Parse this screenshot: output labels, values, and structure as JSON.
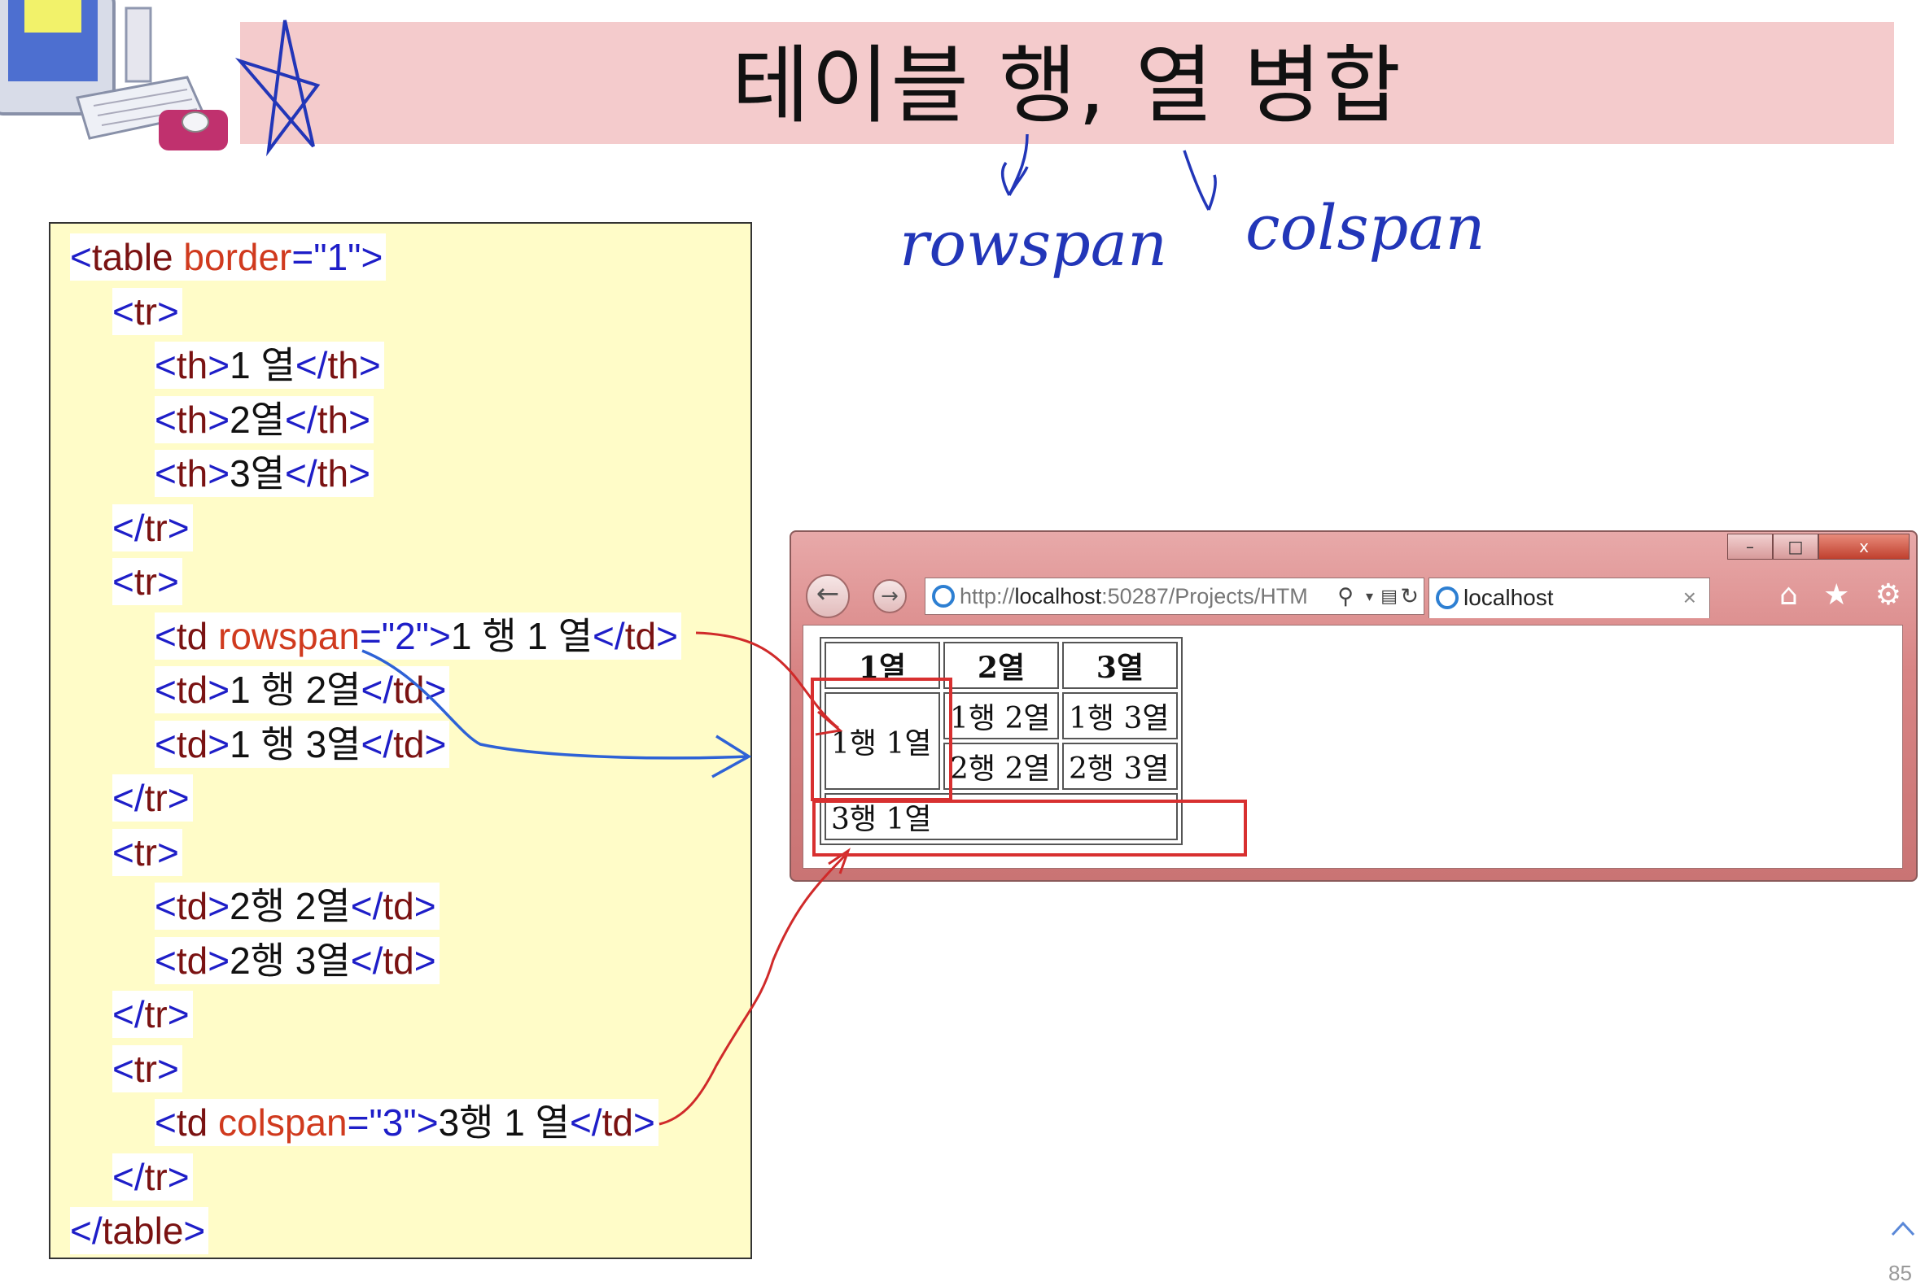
{
  "slide": {
    "title": "테이블 행, 열 병합",
    "page_number": "85"
  },
  "annotations": {
    "rowspan_note": "rowspan",
    "colspan_note": "colspan"
  },
  "code_lines": [
    {
      "indent": 0,
      "tokens": [
        {
          "t": "tag",
          "v": "<"
        },
        {
          "t": "ele",
          "v": "table"
        },
        {
          "t": "attr",
          "v": " border"
        },
        {
          "t": "tag",
          "v": "=\"1\">"
        }
      ]
    },
    {
      "indent": 1,
      "tokens": [
        {
          "t": "tag",
          "v": "<"
        },
        {
          "t": "ele",
          "v": "tr"
        },
        {
          "t": "tag",
          "v": ">"
        }
      ]
    },
    {
      "indent": 2,
      "tokens": [
        {
          "t": "tag",
          "v": "<"
        },
        {
          "t": "ele",
          "v": "th"
        },
        {
          "t": "tag",
          "v": ">"
        },
        {
          "t": "txt",
          "v": "1 열"
        },
        {
          "t": "tag",
          "v": "</"
        },
        {
          "t": "ele",
          "v": "th"
        },
        {
          "t": "tag",
          "v": ">"
        }
      ]
    },
    {
      "indent": 2,
      "tokens": [
        {
          "t": "tag",
          "v": "<"
        },
        {
          "t": "ele",
          "v": "th"
        },
        {
          "t": "tag",
          "v": ">"
        },
        {
          "t": "txt",
          "v": "2열"
        },
        {
          "t": "tag",
          "v": "</"
        },
        {
          "t": "ele",
          "v": "th"
        },
        {
          "t": "tag",
          "v": ">"
        }
      ]
    },
    {
      "indent": 2,
      "tokens": [
        {
          "t": "tag",
          "v": "<"
        },
        {
          "t": "ele",
          "v": "th"
        },
        {
          "t": "tag",
          "v": ">"
        },
        {
          "t": "txt",
          "v": "3열"
        },
        {
          "t": "tag",
          "v": "</"
        },
        {
          "t": "ele",
          "v": "th"
        },
        {
          "t": "tag",
          "v": ">"
        }
      ]
    },
    {
      "indent": 1,
      "tokens": [
        {
          "t": "tag",
          "v": "</"
        },
        {
          "t": "ele",
          "v": "tr"
        },
        {
          "t": "tag",
          "v": ">"
        }
      ]
    },
    {
      "indent": 1,
      "tokens": [
        {
          "t": "tag",
          "v": "<"
        },
        {
          "t": "ele",
          "v": "tr"
        },
        {
          "t": "tag",
          "v": ">"
        }
      ]
    },
    {
      "indent": 2,
      "tokens": [
        {
          "t": "tag",
          "v": "<"
        },
        {
          "t": "ele",
          "v": "td"
        },
        {
          "t": "attr",
          "v": " rowspan"
        },
        {
          "t": "tag",
          "v": "=\"2\">"
        },
        {
          "t": "txt",
          "v": "1 행 1 열"
        },
        {
          "t": "tag",
          "v": "</"
        },
        {
          "t": "ele",
          "v": "td"
        },
        {
          "t": "tag",
          "v": ">"
        }
      ]
    },
    {
      "indent": 2,
      "tokens": [
        {
          "t": "tag",
          "v": "<"
        },
        {
          "t": "ele",
          "v": "td"
        },
        {
          "t": "tag",
          "v": ">"
        },
        {
          "t": "txt",
          "v": "1 행 2열"
        },
        {
          "t": "tag",
          "v": "</"
        },
        {
          "t": "ele",
          "v": "td"
        },
        {
          "t": "tag",
          "v": ">"
        }
      ]
    },
    {
      "indent": 2,
      "tokens": [
        {
          "t": "tag",
          "v": "<"
        },
        {
          "t": "ele",
          "v": "td"
        },
        {
          "t": "tag",
          "v": ">"
        },
        {
          "t": "txt",
          "v": "1 행 3열"
        },
        {
          "t": "tag",
          "v": "</"
        },
        {
          "t": "ele",
          "v": "td"
        },
        {
          "t": "tag",
          "v": ">"
        }
      ]
    },
    {
      "indent": 1,
      "tokens": [
        {
          "t": "tag",
          "v": "</"
        },
        {
          "t": "ele",
          "v": "tr"
        },
        {
          "t": "tag",
          "v": ">"
        }
      ]
    },
    {
      "indent": 1,
      "tokens": [
        {
          "t": "tag",
          "v": "<"
        },
        {
          "t": "ele",
          "v": "tr"
        },
        {
          "t": "tag",
          "v": ">"
        }
      ]
    },
    {
      "indent": 2,
      "tokens": [
        {
          "t": "tag",
          "v": "<"
        },
        {
          "t": "ele",
          "v": "td"
        },
        {
          "t": "tag",
          "v": ">"
        },
        {
          "t": "txt",
          "v": "2행 2열"
        },
        {
          "t": "tag",
          "v": "</"
        },
        {
          "t": "ele",
          "v": "td"
        },
        {
          "t": "tag",
          "v": ">"
        }
      ]
    },
    {
      "indent": 2,
      "tokens": [
        {
          "t": "tag",
          "v": "<"
        },
        {
          "t": "ele",
          "v": "td"
        },
        {
          "t": "tag",
          "v": ">"
        },
        {
          "t": "txt",
          "v": "2행 3열"
        },
        {
          "t": "tag",
          "v": "</"
        },
        {
          "t": "ele",
          "v": "td"
        },
        {
          "t": "tag",
          "v": ">"
        }
      ]
    },
    {
      "indent": 1,
      "tokens": [
        {
          "t": "tag",
          "v": "</"
        },
        {
          "t": "ele",
          "v": "tr"
        },
        {
          "t": "tag",
          "v": ">"
        }
      ]
    },
    {
      "indent": 1,
      "tokens": [
        {
          "t": "tag",
          "v": "<"
        },
        {
          "t": "ele",
          "v": "tr"
        },
        {
          "t": "tag",
          "v": ">"
        }
      ]
    },
    {
      "indent": 2,
      "tokens": [
        {
          "t": "tag",
          "v": "<"
        },
        {
          "t": "ele",
          "v": "td"
        },
        {
          "t": "attr",
          "v": " colspan"
        },
        {
          "t": "tag",
          "v": "=\"3\">"
        },
        {
          "t": "txt",
          "v": "3행 1 열"
        },
        {
          "t": "tag",
          "v": "</"
        },
        {
          "t": "ele",
          "v": "td"
        },
        {
          "t": "tag",
          "v": ">"
        }
      ]
    },
    {
      "indent": 1,
      "tokens": [
        {
          "t": "tag",
          "v": "</"
        },
        {
          "t": "ele",
          "v": "tr"
        },
        {
          "t": "tag",
          "v": ">"
        }
      ]
    },
    {
      "indent": 0,
      "tokens": [
        {
          "t": "tag",
          "v": "</"
        },
        {
          "t": "ele",
          "v": "table"
        },
        {
          "t": "tag",
          "v": ">"
        }
      ]
    }
  ],
  "browser": {
    "address_url_prefix": "http://",
    "address_url_host": "localhost",
    "address_url_rest": ":50287/Projects/HTM",
    "tab_title": "localhost",
    "tab_close": "×",
    "window_controls": {
      "minimize": "–",
      "maximize": "□",
      "close": "x"
    },
    "icons": {
      "back": "back-arrow-icon",
      "forward": "forward-arrow-icon",
      "home": "home-icon",
      "favorites": "star-icon",
      "settings": "gear-icon",
      "search": "search-icon",
      "refresh": "refresh-icon",
      "compat": "compat-view-icon"
    },
    "table": {
      "headers": [
        "1열",
        "2열",
        "3열"
      ],
      "r1c1": "1행 1열",
      "r1c2": "1행 2열",
      "r1c3": "1행 3열",
      "r2c2": "2행 2열",
      "r2c3": "2행 3열",
      "r3c1": "3행 1열"
    }
  },
  "colors": {
    "title_band": "#f4cbcc",
    "code_background": "#fffcc8",
    "tag_blue": "#1e1ec8",
    "element_maroon": "#7a1212",
    "attribute_red": "#d03a1e",
    "ink_blue": "#2236b8",
    "ink_red": "#d02a2a"
  }
}
